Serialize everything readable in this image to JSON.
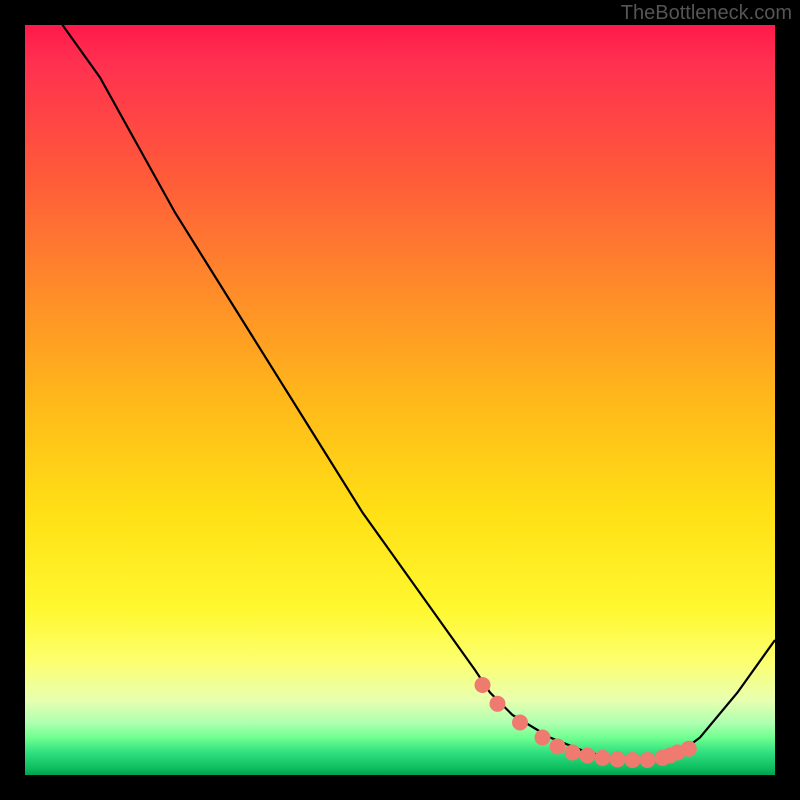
{
  "watermark": "TheBottleneck.com",
  "chart_data": {
    "type": "line",
    "title": "",
    "xlabel": "",
    "ylabel": "",
    "xlim": [
      0,
      100
    ],
    "ylim": [
      0,
      100
    ],
    "series": [
      {
        "name": "bottleneck-curve",
        "x": [
          5,
          10,
          15,
          20,
          25,
          30,
          35,
          40,
          45,
          50,
          55,
          60,
          62,
          65,
          70,
          75,
          80,
          83,
          85,
          88,
          90,
          95,
          100
        ],
        "values": [
          100,
          93,
          84,
          75,
          67,
          59,
          51,
          43,
          35,
          28,
          21,
          14,
          11,
          8,
          5,
          3,
          2,
          2,
          2.5,
          3.5,
          5,
          11,
          18
        ]
      }
    ],
    "markers": {
      "name": "highlight-dots",
      "color": "#ef7a6f",
      "x": [
        61,
        63,
        66,
        69,
        71,
        73,
        75,
        77,
        79,
        81,
        83,
        85,
        86,
        87,
        88.5
      ],
      "values": [
        12,
        9.5,
        7,
        5,
        3.8,
        3,
        2.6,
        2.3,
        2.1,
        2,
        2,
        2.3,
        2.6,
        3,
        3.5
      ]
    }
  }
}
